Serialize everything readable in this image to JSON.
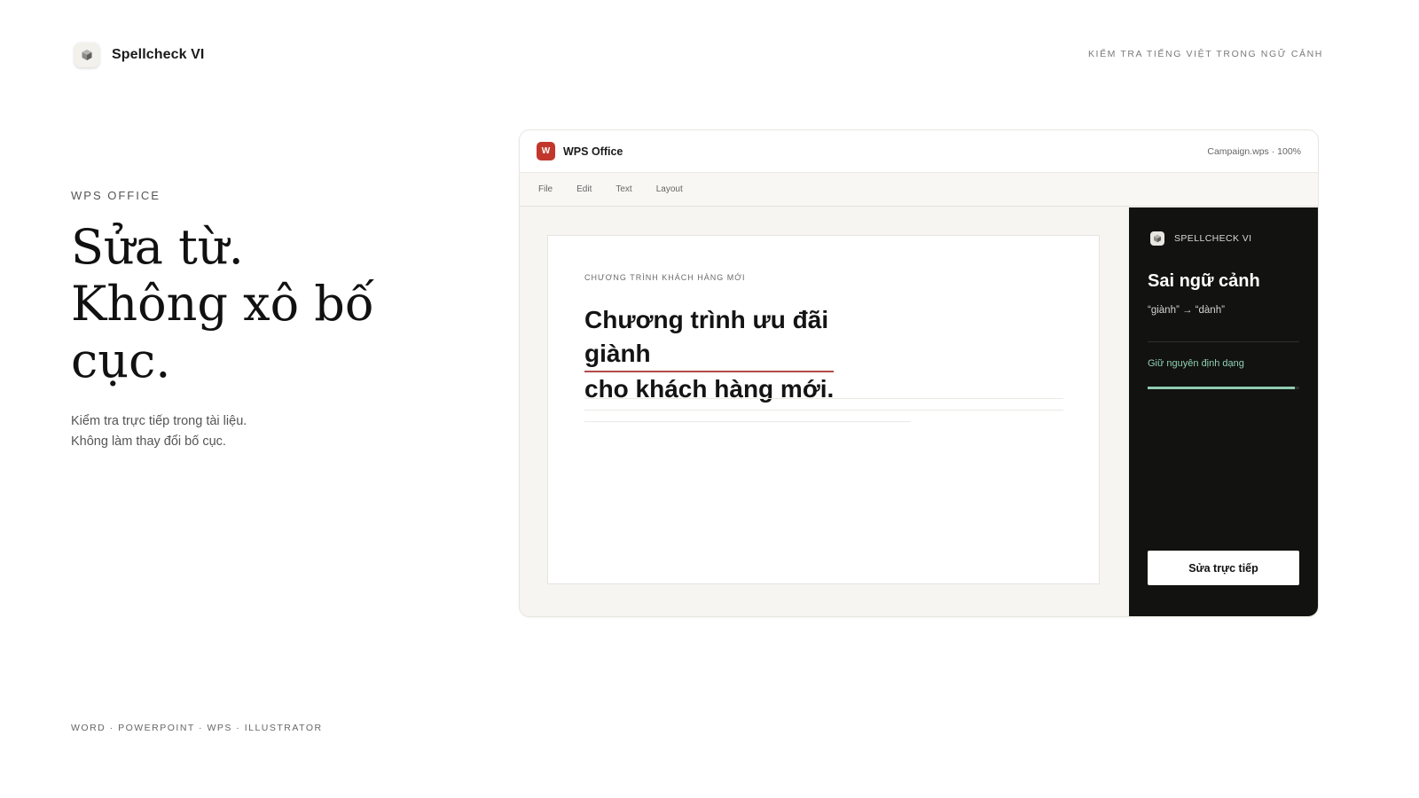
{
  "brand": {
    "name": "Spellcheck VI",
    "logo_icon": "cube-icon"
  },
  "tagline": "KIỂM TRA TIẾNG VIỆT TRONG NGỮ CẢNH",
  "hero": {
    "eyebrow": "WPS OFFICE",
    "headline": [
      "Sửa từ.",
      "Không xô bố",
      "cục."
    ],
    "description": [
      "Kiểm tra trực tiếp trong tài liệu.",
      "Không làm thay đổi bố cục."
    ]
  },
  "platforms": "WORD · POWERPOINT · WPS · ILLUSTRATOR",
  "app_window": {
    "app_icon_letter": "W",
    "app_name": "WPS Office",
    "file_info": "Campaign.wps · 100%",
    "menu": [
      "File",
      "Edit",
      "Text",
      "Layout"
    ],
    "document": {
      "eyebrow": "CHƯƠNG TRÌNH KHÁCH HÀNG MỚI",
      "title_line1_prefix": "Chương trình ưu đãi ",
      "title_error_word": "giành",
      "title_line2": "cho khách hàng mới.",
      "error_underline_color": "#b34a4a"
    },
    "panel": {
      "brand": "SPELLCHECK VI",
      "issue_title": "Sai ngữ cảnh",
      "issue_detail": "“giành” → “dành”",
      "preserve_label": "Giữ nguyên định dạng",
      "progress": 0.97,
      "fix_button": "Sửa trực tiếp",
      "accent_color": "#8fcdb2"
    }
  }
}
